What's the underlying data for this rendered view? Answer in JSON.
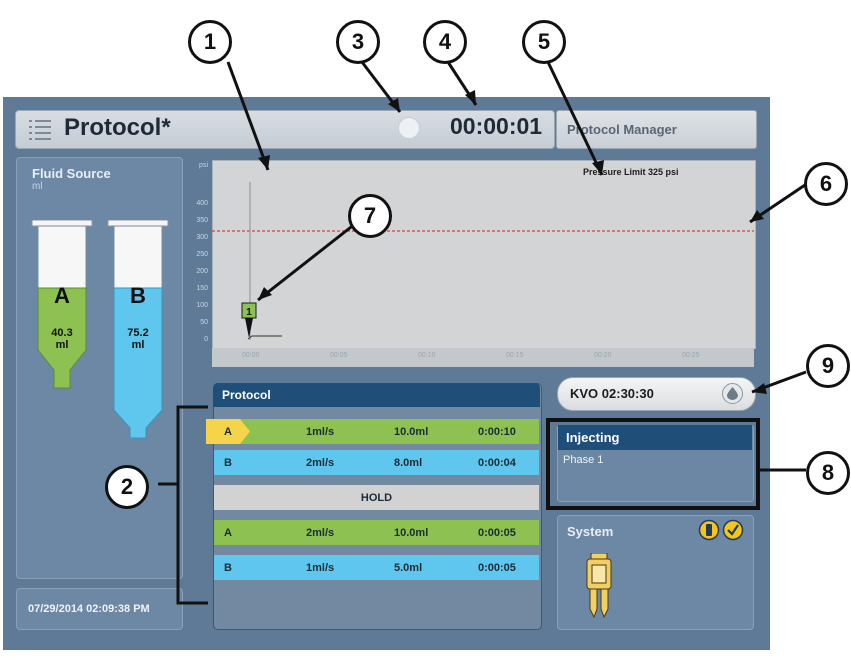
{
  "header": {
    "title": "Protocol*",
    "elapsed": "00:00:01",
    "manager_button": "Protocol Manager"
  },
  "fluid_source": {
    "title": "Fluid Source",
    "unit": "ml",
    "syringes": [
      {
        "label": "A",
        "volume": "40.3",
        "unit": "ml",
        "color": "#8dc152",
        "fill_fraction": 0.55
      },
      {
        "label": "B",
        "volume": "75.2",
        "unit": "ml",
        "color": "#5fc7ee",
        "fill_fraction": 0.85
      }
    ]
  },
  "datetime": "07/29/2014 02:09:38 PM",
  "pressure_chart": {
    "y_unit": "psi",
    "y_ticks": [
      "400",
      "350",
      "300",
      "250",
      "200",
      "150",
      "100",
      "50",
      "0"
    ],
    "x_ticks": [
      "00:00",
      "00:05",
      "00:10",
      "00:15",
      "00:20",
      "00:25"
    ],
    "limit_label": "Pressure Limit 325 psi",
    "limit_value": 325,
    "limit_color": "#e53935",
    "phase_marker": "1"
  },
  "protocol": {
    "title": "Protocol",
    "rows": [
      {
        "source": "A",
        "rate": "1ml/s",
        "volume": "10.0ml",
        "duration": "0:00:10",
        "color": "#8dc152",
        "active": true
      },
      {
        "source": "B",
        "rate": "2ml/s",
        "volume": "8.0ml",
        "duration": "0:00:04",
        "color": "#5fc7ee",
        "active": false
      },
      {
        "hold": "HOLD",
        "color": "#d2d2d2"
      },
      {
        "source": "A",
        "rate": "2ml/s",
        "volume": "10.0ml",
        "duration": "0:00:05",
        "color": "#8dc152",
        "active": false
      },
      {
        "source": "B",
        "rate": "1ml/s",
        "volume": "5.0ml",
        "duration": "0:00:05",
        "color": "#5fc7ee",
        "active": false
      }
    ]
  },
  "kvo": {
    "label": "KVO 02:30:30"
  },
  "injecting": {
    "title": "Injecting",
    "phase": "Phase 1"
  },
  "system": {
    "title": "System"
  },
  "callouts": [
    "1",
    "2",
    "3",
    "4",
    "5",
    "6",
    "7",
    "8",
    "9"
  ]
}
